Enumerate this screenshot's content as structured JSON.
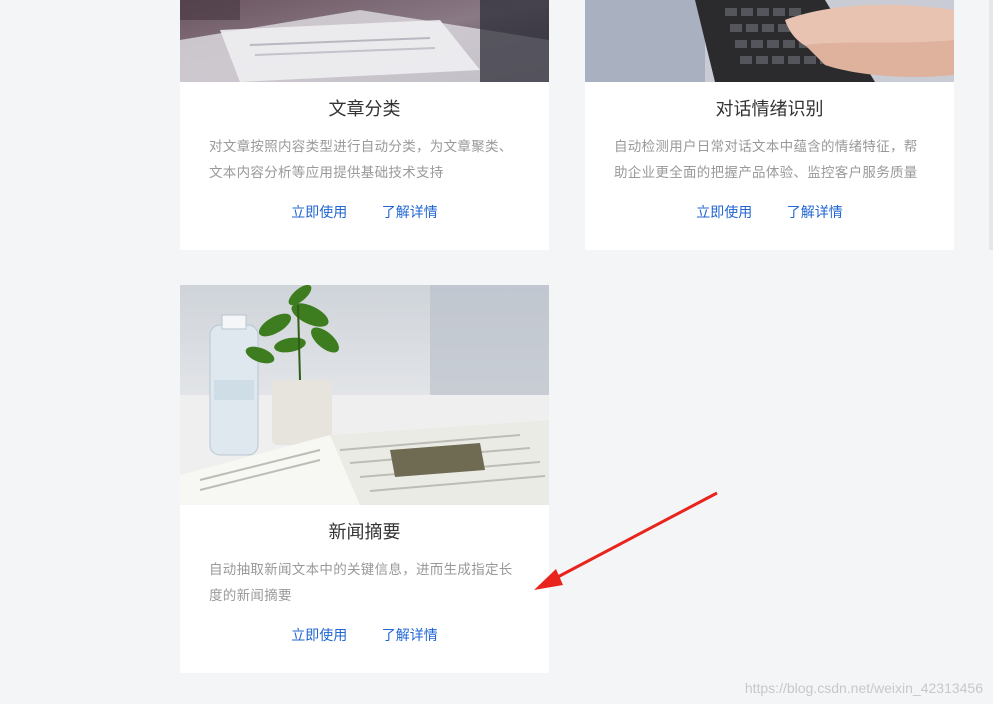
{
  "cards": [
    {
      "title": "文章分类",
      "desc_line1": "对文章按照内容类型进行自动分类，为文章聚类、",
      "desc_line2": "文本内容分析等应用提供基础技术支持",
      "action_use": "立即使用",
      "action_detail": "了解详情",
      "image": "desk-documents-photo"
    },
    {
      "title": "对话情绪识别",
      "desc_line1": "自动检测用户日常对话文本中蕴含的情绪特征，帮",
      "desc_line2": "助企业更全面的把握产品体验、监控客户服务质量",
      "action_use": "立即使用",
      "action_detail": "了解详情",
      "image": "keyboard-typing-photo"
    },
    {
      "title": "新闻摘要",
      "desc_line1": "自动抽取新闻文本中的关键信息，进而生成指定长",
      "desc_line2": "度的新闻摘要",
      "action_use": "立即使用",
      "action_detail": "了解详情",
      "image": "newspaper-plant-photo"
    }
  ],
  "annotation": {
    "color": "#e8241c",
    "icon": "red-arrow-annotation"
  },
  "watermark": "https://blog.csdn.net/weixin_42313456"
}
